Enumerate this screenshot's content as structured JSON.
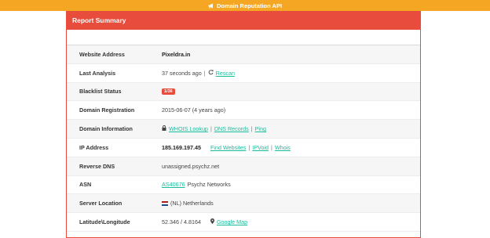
{
  "topbar": {
    "title": "Domain Reputation API",
    "icon": "bullhorn-icon"
  },
  "panel": {
    "title": "Report Summary"
  },
  "rows": {
    "website_address": {
      "label": "Website Address",
      "value": "Pixeldra.in"
    },
    "last_analysis": {
      "label": "Last Analysis",
      "value": "37 seconds ago",
      "sep": "|",
      "rescan": "Rescan",
      "icon": "refresh-icon"
    },
    "blacklist_status": {
      "label": "Blacklist Status",
      "badge": "1/36"
    },
    "domain_registration": {
      "label": "Domain Registration",
      "value": "2015-06-07 (4 years ago)"
    },
    "domain_information": {
      "label": "Domain Information",
      "icon": "lock-icon",
      "whois": "WHOIS Lookup",
      "sep1": "|",
      "dns": "DNS Records",
      "sep2": "|",
      "ping": "Ping"
    },
    "ip_address": {
      "label": "IP Address",
      "value": "185.169.197.45",
      "find": "Find Websites",
      "sep1": "|",
      "ipvoid": "IPVoid",
      "sep2": "|",
      "whois": "Whois"
    },
    "reverse_dns": {
      "label": "Reverse DNS",
      "value": "unassigned.psychz.net"
    },
    "asn": {
      "label": "ASN",
      "asn": "AS40676",
      "name": "Psychz Networks"
    },
    "server_location": {
      "label": "Server Location",
      "value": "(NL) Netherlands",
      "flag_colors": [
        "#ae1c28",
        "#ffffff",
        "#21468b"
      ]
    },
    "latlong": {
      "label": "Latitude\\Longitude",
      "value": "52.346 / 4.8164",
      "map": "Google Map",
      "icon": "map-marker-icon"
    }
  },
  "colors": {
    "topbar": "#f5a623",
    "panel_header": "#e74c3c",
    "link": "#1abc9c",
    "badge": "#e74c3c"
  }
}
